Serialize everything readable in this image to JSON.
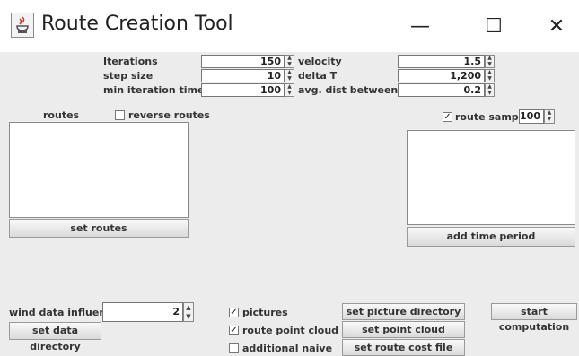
{
  "window": {
    "title": "Route Creation Tool",
    "minimize_glyph": "—",
    "maximize_glyph": "☐",
    "close_glyph": "✕"
  },
  "params_left": [
    {
      "label": "Iterations",
      "value": "150"
    },
    {
      "label": "step size",
      "value": "10"
    },
    {
      "label": "min iteration time",
      "value": "100"
    }
  ],
  "params_right": [
    {
      "label": "velocity",
      "value": "1.5"
    },
    {
      "label": "delta T",
      "value": "1,200"
    },
    {
      "label": "avg. dist between points",
      "value": "0.2"
    }
  ],
  "routes": {
    "label": "routes",
    "reverse_label": "reverse routes",
    "reverse_checked": false,
    "set_routes_label": "set routes"
  },
  "sampling": {
    "label": "route sampling",
    "checked": true,
    "value": "100",
    "add_time_period_label": "add time period"
  },
  "wind": {
    "label": "wind data influence",
    "value": "2",
    "set_data_directory_label": "set data directory"
  },
  "options": [
    {
      "label": "pictures",
      "checked": true
    },
    {
      "label": "route point cloud",
      "checked": true
    },
    {
      "label": "additional naive",
      "checked": false
    }
  ],
  "buttons": {
    "set_picture_directory": "set picture directory",
    "set_point_cloud_directory": "set point cloud directory",
    "set_route_cost_file": "set route cost file",
    "start_computation": "start computation"
  }
}
